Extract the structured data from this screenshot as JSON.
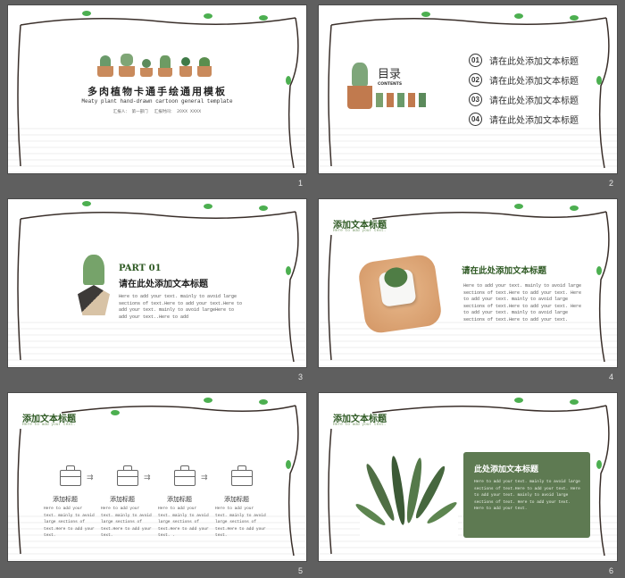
{
  "slides": [
    {
      "num": "1",
      "title": "多肉植物卡通手绘通用模板",
      "subtitle": "Meaty plant hand-drawn cartoon general template",
      "meta": "汇报人：  第一部门     汇报时间：  20XX  XXXX"
    },
    {
      "num": "2",
      "toc_title": "目录",
      "toc_sub": "CONTENTS",
      "items": [
        {
          "n": "01",
          "label": "请在此处添加文本标题"
        },
        {
          "n": "02",
          "label": "请在此处添加文本标题"
        },
        {
          "n": "03",
          "label": "请在此处添加文本标题"
        },
        {
          "n": "04",
          "label": "请在此处添加文本标题"
        }
      ]
    },
    {
      "num": "3",
      "part": "PART 01",
      "heading": "请在此处添加文本标题",
      "body": "Here to add your text. mainly to avoid large sections of text.Here to add your text.Here to add your text. mainly to avoid largeHere to add your text..Here to add"
    },
    {
      "num": "4",
      "header": "添加文本标题",
      "header_sub": "Here to add your text.",
      "heading": "请在此处添加文本标题",
      "body": "Here to add your text. mainly to avoid large sections of text.Here to add your text. Here to add your text. mainly to avoid large sections of text.Here to add your text. Here to add your text. mainly to avoid large sections of text.Here to add your text."
    },
    {
      "num": "5",
      "header": "添加文本标题",
      "header_sub": "Here to add your text.",
      "cols": [
        {
          "label": "添加标题",
          "text": "Here to add your text. mainly to avoid large sections of text.Here to add your text."
        },
        {
          "label": "添加标题",
          "text": "Here to add your text. mainly to avoid large sections of text.Here to add your text."
        },
        {
          "label": "添加标题",
          "text": "Here to add your text. mainly to avoid large sections of text.Here to add your text. ."
        },
        {
          "label": "添加标题",
          "text": "Here to add your text. mainly to avoid large sections of text.Here to add your text."
        }
      ]
    },
    {
      "num": "6",
      "header": "添加文本标题",
      "header_sub": "Here to add your text.",
      "box_title": "此处添加文本标题",
      "box_body": "Here to add your text. mainly to avoid large sections of text.Here to add your text. Here to add your text. mainly to avoid large sections of text. Here to add your text. Here to add your text."
    }
  ],
  "colors": {
    "accent": "#2f5a24",
    "box": "#5e7a52",
    "bg": "#5f5f5f"
  }
}
